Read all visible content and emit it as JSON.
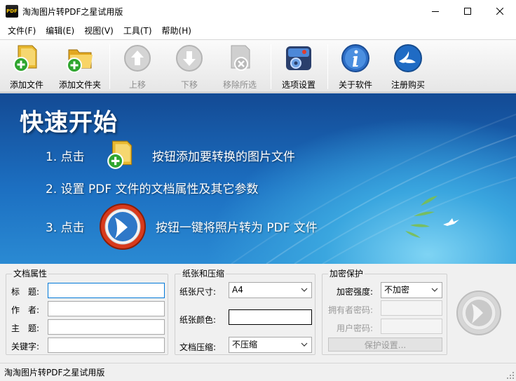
{
  "window": {
    "title": "淘淘图片转PDF之星试用版",
    "icon_text": "PDF"
  },
  "menu": [
    "文件(F)",
    "编辑(E)",
    "视图(V)",
    "工具(T)",
    "帮助(H)"
  ],
  "toolbar": {
    "add_file": "添加文件",
    "add_folder": "添加文件夹",
    "move_up": "上移",
    "move_down": "下移",
    "remove_selected": "移除所选",
    "options": "选项设置",
    "about": "关于软件",
    "register": "注册购买"
  },
  "banner": {
    "title": "快速开始",
    "step1_prefix": "1. 点击",
    "step1_suffix": "按钮添加要转换的图片文件",
    "step2": "2. 设置 PDF 文件的文档属性及其它参数",
    "step3_prefix": "3. 点击",
    "step3_suffix": "按钮一键将照片转为 PDF 文件"
  },
  "doc_props": {
    "group": "文档属性",
    "title_label": "标　题:",
    "author_label": "作　者:",
    "subject_label": "主　题:",
    "keywords_label": "关键字:",
    "title_value": "",
    "author_value": "",
    "subject_value": "",
    "keywords_value": ""
  },
  "paper": {
    "group": "纸张和压缩",
    "size_label": "纸张尺寸:",
    "size_value": "A4",
    "color_label": "纸张颜色:",
    "compress_label": "文档压缩:",
    "compress_value": "不压缩"
  },
  "encrypt": {
    "group": "加密保护",
    "strength_label": "加密强度:",
    "strength_value": "不加密",
    "owner_pw_label": "拥有者密码:",
    "user_pw_label": "用户密码:",
    "protect_button": "保护设置..."
  },
  "status": {
    "text": "淘淘图片转PDF之星试用版"
  },
  "colors": {
    "banner_dark": "#134a94",
    "banner_light": "#7fd4f4",
    "focus_border": "#0078d7",
    "paper_color": "#ffffff"
  }
}
